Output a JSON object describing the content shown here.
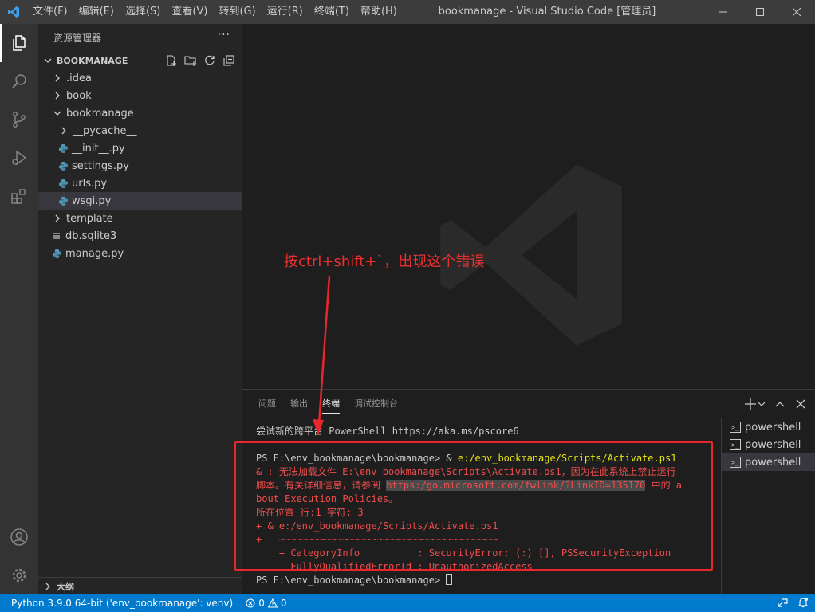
{
  "window": {
    "title": "bookmanage - Visual Studio Code [管理员]",
    "menu": [
      "文件(F)",
      "编辑(E)",
      "选择(S)",
      "查看(V)",
      "转到(G)",
      "运行(R)",
      "终端(T)",
      "帮助(H)"
    ]
  },
  "sidebar": {
    "title": "资源管理器",
    "more": "···",
    "section": "BOOKMANAGE",
    "tree": [
      {
        "label": ".idea",
        "kind": "folder-collapsed",
        "depth": 0
      },
      {
        "label": "book",
        "kind": "folder-collapsed",
        "depth": 0
      },
      {
        "label": "bookmanage",
        "kind": "folder-expanded",
        "depth": 0
      },
      {
        "label": "__pycache__",
        "kind": "folder-collapsed",
        "depth": 1
      },
      {
        "label": "__init__.py",
        "kind": "python-file",
        "depth": 1
      },
      {
        "label": "settings.py",
        "kind": "python-file",
        "depth": 1
      },
      {
        "label": "urls.py",
        "kind": "python-file",
        "depth": 1
      },
      {
        "label": "wsgi.py",
        "kind": "python-file",
        "depth": 1,
        "selected": true
      },
      {
        "label": "template",
        "kind": "folder-collapsed",
        "depth": 0
      },
      {
        "label": "db.sqlite3",
        "kind": "file",
        "depth": 0
      },
      {
        "label": "manage.py",
        "kind": "python-file",
        "depth": 0
      }
    ],
    "outline": "大纲"
  },
  "panel": {
    "tabs": [
      "问题",
      "输出",
      "终端",
      "调试控制台"
    ],
    "active_tab": "终端",
    "terminal_lines": {
      "l1": "尝试新的跨平台 PowerShell https://aka.ms/pscore6",
      "l2_prompt": "PS E:\\env_bookmanage\\bookmanage> & ",
      "l2_cmd": "e:/env_bookmanage/Scripts/Activate.ps1",
      "l3": "& : 无法加载文件 E:\\env_bookmanage\\Scripts\\Activate.ps1，因为在此系统上禁止运行",
      "l4_a": "脚本。有关详细信息，请参阅 ",
      "l4_link": "https:/go.microsoft.com/fwlink/?LinkID=135170",
      "l4_b": " 中的 a",
      "l5": "bout_Execution_Policies。",
      "l6": "所在位置 行:1 字符: 3",
      "l7": "+ & e:/env_bookmanage/Scripts/Activate.ps1",
      "l8": "+   ~~~~~~~~~~~~~~~~~~~~~~~~~~~~~~~~~~~~~~",
      "l9": "    + CategoryInfo          : SecurityError: (:) [], PSSecurityException",
      "l10": "    + FullyQualifiedErrorId : UnauthorizedAccess",
      "l11": "PS E:\\env_bookmanage\\bookmanage> "
    },
    "terminals": [
      "powershell",
      "powershell",
      "powershell"
    ],
    "selected_terminal": 2
  },
  "statusbar": {
    "python": "Python 3.9.0 64-bit ('env_bookmanage': venv)",
    "errors": "0",
    "warnings": "0"
  },
  "annotation": {
    "text": "按ctrl+shift+`，出现这个错误",
    "color": "#e8262e"
  },
  "colors": {
    "accent": "#007acc",
    "error": "#f14c4c",
    "highlight": "#e5e510"
  }
}
